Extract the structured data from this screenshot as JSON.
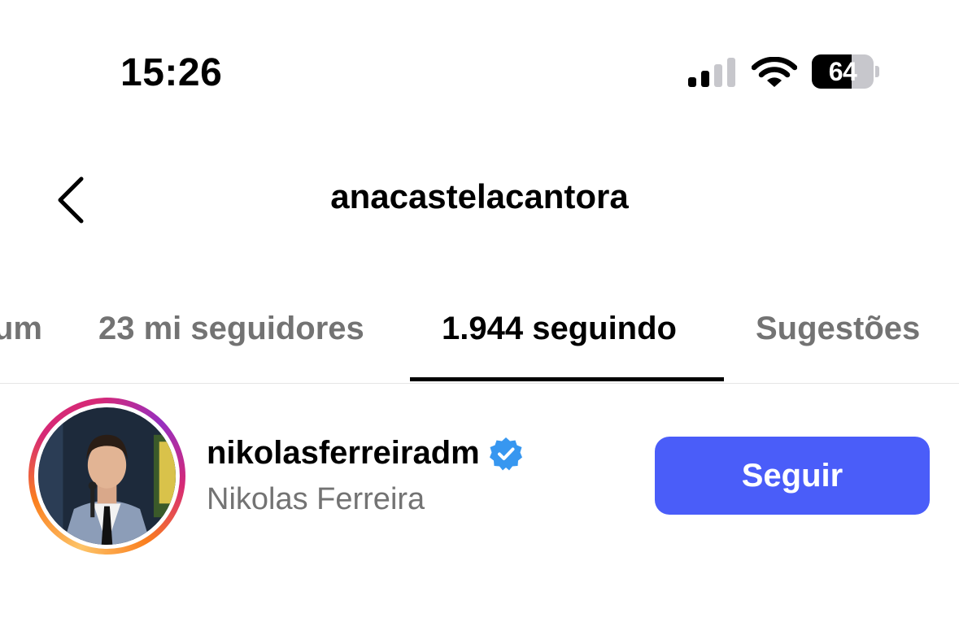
{
  "status_bar": {
    "time": "15:26",
    "battery_percent": "64",
    "battery_level": 0.64,
    "signal_bars_active": 2,
    "signal_bars_total": 4
  },
  "header": {
    "title": "anacastelacantora",
    "back_icon": "chevron-left-icon"
  },
  "tabs": [
    {
      "label": "um",
      "active": false
    },
    {
      "label": "23 mi seguidores",
      "active": false
    },
    {
      "label": "1.944 seguindo",
      "active": true
    },
    {
      "label": "Sugestões",
      "active": false
    }
  ],
  "accounts": [
    {
      "username": "nikolasferreiradm",
      "verified": true,
      "full_name": "Nikolas Ferreira",
      "button_label": "Seguir"
    }
  ],
  "colors": {
    "accent_button": "#4a5df9",
    "verified_badge": "#3797f0",
    "muted_text": "#737373"
  }
}
